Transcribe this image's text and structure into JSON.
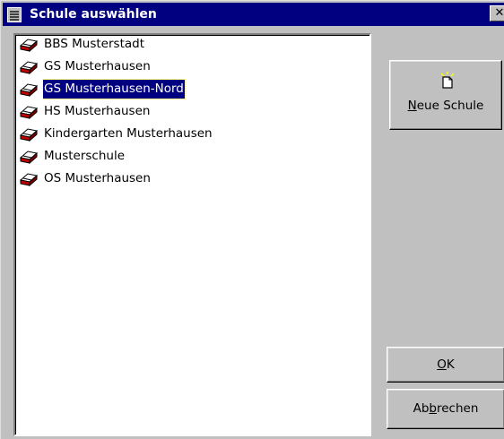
{
  "window": {
    "title": "Schule auswählen",
    "close_label": "✕"
  },
  "schools": {
    "items": [
      {
        "label": "BBS Musterstadt",
        "selected": false
      },
      {
        "label": "GS Musterhausen",
        "selected": false
      },
      {
        "label": "GS Musterhausen-Nord",
        "selected": true
      },
      {
        "label": "HS Musterhausen",
        "selected": false
      },
      {
        "label": "Kindergarten Musterhausen",
        "selected": false
      },
      {
        "label": "Musterschule",
        "selected": false
      },
      {
        "label": "OS Musterhausen",
        "selected": false
      }
    ],
    "item_icon": "school-book-icon"
  },
  "buttons": {
    "new_school": {
      "accel": "N",
      "rest": "eue Schule",
      "icon": "new-document-icon"
    },
    "ok": {
      "accel": "O",
      "rest": "K"
    },
    "cancel": {
      "pre": "Ab",
      "accel": "b",
      "rest": "rechen"
    }
  },
  "colors": {
    "title_bar": "#000080",
    "selection": "#000080",
    "face": "#c0c0c0"
  }
}
